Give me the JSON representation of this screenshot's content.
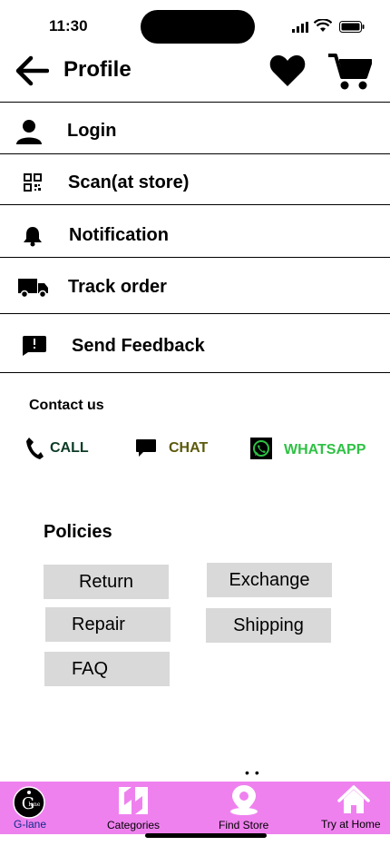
{
  "status_bar": {
    "time": "11:30"
  },
  "header": {
    "title": "Profile"
  },
  "menu": [
    {
      "label": "Login",
      "icon": "person-icon"
    },
    {
      "label": "Scan(at store)",
      "icon": "qr-code-icon"
    },
    {
      "label": "Notification",
      "icon": "bell-icon"
    },
    {
      "label": "Track order",
      "icon": "truck-icon"
    },
    {
      "label": "Send Feedback",
      "icon": "feedback-icon"
    }
  ],
  "contact": {
    "title": "Contact us",
    "call": "CALL",
    "chat": "CHAT",
    "whatsapp": "WHATSAPP"
  },
  "policies": {
    "title": "Policies",
    "items": [
      "Return",
      "Exchange",
      "Repair",
      "Shipping",
      "FAQ"
    ]
  },
  "nav": {
    "items": [
      {
        "label": "G-lane",
        "icon": "glane-logo-icon"
      },
      {
        "label": "Categories",
        "icon": "categories-icon"
      },
      {
        "label": "Find Store",
        "icon": "location-pin-icon"
      },
      {
        "label": "Try at Home",
        "icon": "home-icon"
      }
    ]
  },
  "colors": {
    "nav_bg": "#ef81ef",
    "policy_bg": "#d9d9d9",
    "call": "#0c3b25",
    "chat": "#5c5a0a",
    "whatsapp": "#2fc145"
  }
}
